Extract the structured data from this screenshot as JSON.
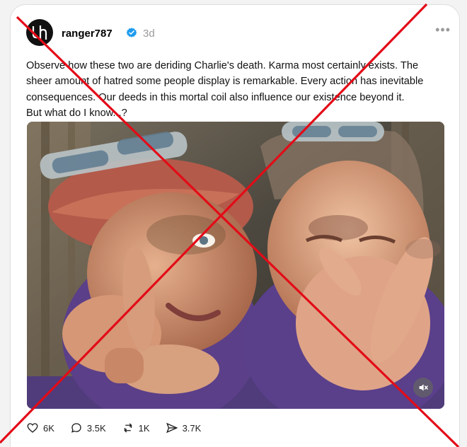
{
  "user": {
    "username": "ranger787",
    "timestamp": "3d"
  },
  "post": {
    "lines": [
      "Observe how these two are deriding Charlie's death. Karma most certainly exists. The",
      "sheer amount of hatred some people display is remarkable. Every action has inevitable",
      "consequences. Our deeds in this mortal coil also influence our existence beyond it.",
      "But what do I know...?"
    ]
  },
  "actions": {
    "likes": "6K",
    "comments": "3.5K",
    "reposts": "1K",
    "shares": "3.7K"
  },
  "overlay": {
    "color": "#e30b17"
  }
}
